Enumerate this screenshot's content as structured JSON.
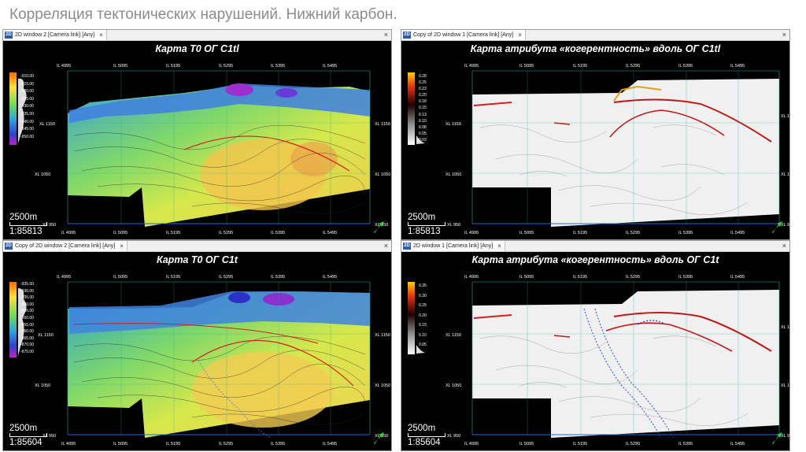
{
  "slide": {
    "title": "Корреляция тектонических нарушений. Нижний карбон."
  },
  "windows": [
    {
      "tab_label": "2D window 2 [Camera link] [Any]",
      "caption": "Карта Т0 ОГ C1tl",
      "scale_text": "2500m",
      "ratio_text": "1:85813",
      "legend": [
        "-910.00",
        "-915.00",
        "-920.00",
        "-925.00",
        "-930.00",
        "-935.00",
        "-940.00",
        "-845.00",
        "-850.00"
      ]
    },
    {
      "tab_label": "Copy of 2D window 1 [Camera link] [Any]",
      "caption": "Карта атрибута «когерентность» вдоль ОГ C1tl",
      "scale_text": "2500m",
      "ratio_text": "1:85813",
      "legend": [
        "0.28",
        "0.25",
        "0.23",
        "0.20",
        "0.18",
        "0.15",
        "0.13",
        "0.10",
        "0.08",
        "0.05",
        "0.03"
      ]
    },
    {
      "tab_label": "Copy of 2D window 2 [Camera link] [Any]",
      "caption": "Карта Т0 ОГ C1t",
      "scale_text": "2500m",
      "ratio_text": "1:85604",
      "legend": [
        "-935.00",
        "-930.00",
        "-935.00",
        "-840.00",
        "-845.00",
        "-850.00",
        "-855.00",
        "-860.00",
        "-865.00",
        "-870.00",
        "-875.00"
      ]
    },
    {
      "tab_label": "2D window 1 [Camera link] [Any]",
      "caption": "Карта атрибута «когерентность» вдоль ОГ C1t",
      "scale_text": "2500m",
      "ratio_text": "1:85604",
      "legend": [
        "0.35",
        "0.30",
        "0.25",
        "0.20",
        "0.15",
        "0.10",
        "0.05"
      ]
    }
  ],
  "inlines": [
    "IL 4995",
    "IL 5095",
    "IL 5195",
    "IL 5295",
    "IL 5395",
    "IL 5495"
  ],
  "crosslines": [
    "XL 1150",
    "XL 1050",
    "XL 950"
  ],
  "icons": {
    "tab": "2d-window-icon",
    "close": "close-icon",
    "north": "north-arrow-icon"
  }
}
